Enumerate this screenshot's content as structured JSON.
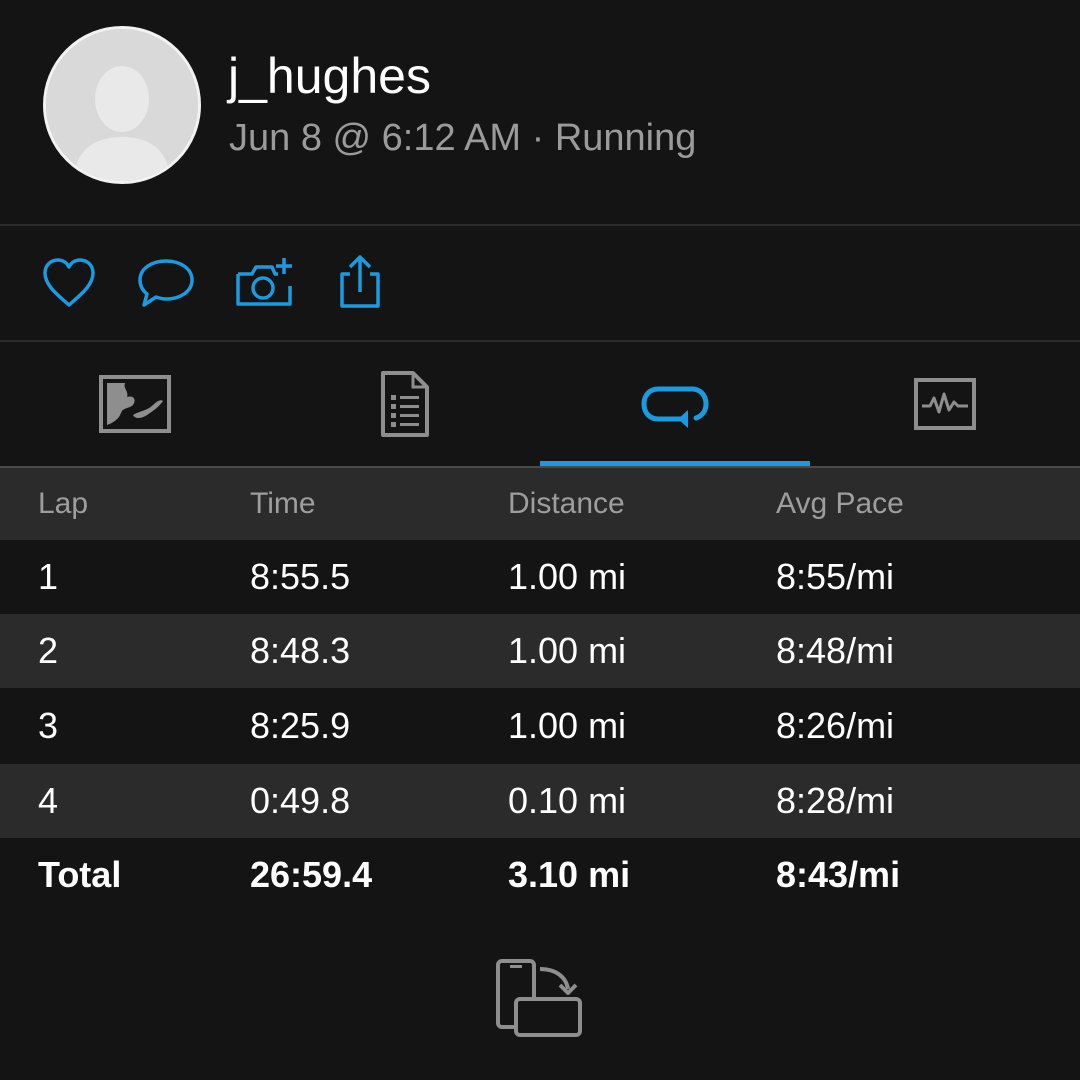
{
  "user": {
    "username": "j_hughes",
    "meta": "Jun 8 @ 6:12 AM · Running"
  },
  "actions": [
    {
      "name": "like",
      "icon": "heart-icon"
    },
    {
      "name": "comment",
      "icon": "comment-icon"
    },
    {
      "name": "add-photo",
      "icon": "camera-plus-icon"
    },
    {
      "name": "share",
      "icon": "share-icon"
    }
  ],
  "tabs": [
    {
      "name": "map",
      "icon": "map-icon",
      "active": false
    },
    {
      "name": "details",
      "icon": "document-list-icon",
      "active": false
    },
    {
      "name": "laps",
      "icon": "laps-loop-icon",
      "active": true
    },
    {
      "name": "charts",
      "icon": "activity-chart-icon",
      "active": false
    }
  ],
  "laps_table": {
    "headers": [
      "Lap",
      "Time",
      "Distance",
      "Avg Pace"
    ],
    "rows": [
      [
        "1",
        "8:55.5",
        "1.00 mi",
        "8:55/mi"
      ],
      [
        "2",
        "8:48.3",
        "1.00 mi",
        "8:48/mi"
      ],
      [
        "3",
        "8:25.9",
        "1.00 mi",
        "8:26/mi"
      ],
      [
        "4",
        "0:49.8",
        "0.10 mi",
        "8:28/mi"
      ]
    ],
    "total": [
      "Total",
      "26:59.4",
      "3.10 mi",
      "8:43/mi"
    ]
  },
  "footer": {
    "icon": "rotate-screen-icon"
  },
  "colors": {
    "accent": "#1b9ae0",
    "background": "#141414",
    "row_alt": "#2b2b2b",
    "icon_gray": "#8e8e8e",
    "secondary_text": "#9b9b9b"
  }
}
